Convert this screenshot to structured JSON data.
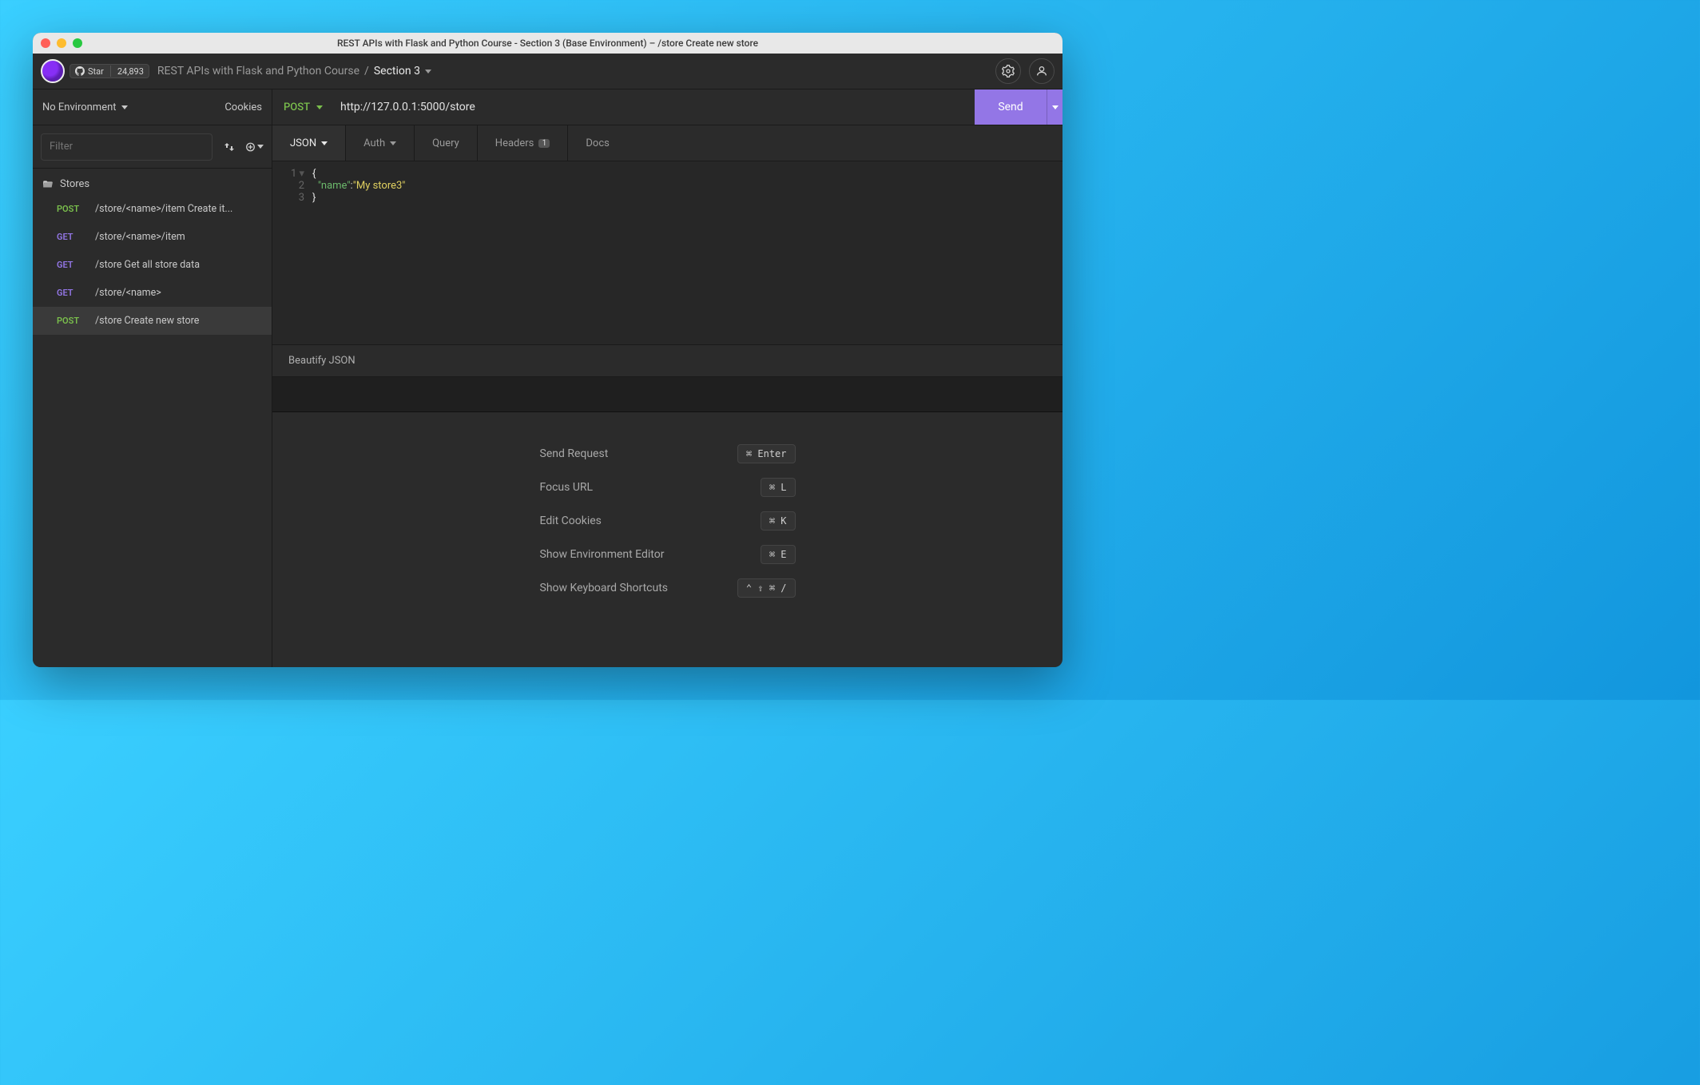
{
  "window": {
    "title": "REST APIs with Flask and Python Course - Section 3 (Base Environment) – /store Create new store"
  },
  "github": {
    "star_label": "Star",
    "star_count": "24,893"
  },
  "breadcrumb": {
    "project": "REST APIs with Flask and Python Course",
    "separator": "/",
    "current": "Section 3"
  },
  "sidebar": {
    "environment_label": "No Environment",
    "cookies_label": "Cookies",
    "filter_placeholder": "Filter",
    "folder_name": "Stores",
    "items": [
      {
        "method": "POST",
        "method_class": "post",
        "path": "/store/<name>/item Create it...",
        "active": false
      },
      {
        "method": "GET",
        "method_class": "get",
        "path": "/store/<name>/item",
        "active": false
      },
      {
        "method": "GET",
        "method_class": "get",
        "path": "/store Get all store data",
        "active": false
      },
      {
        "method": "GET",
        "method_class": "get",
        "path": "/store/<name>",
        "active": false
      },
      {
        "method": "POST",
        "method_class": "post",
        "path": "/store Create new store",
        "active": true
      }
    ]
  },
  "request": {
    "method": "POST",
    "url": "http://127.0.0.1:5000/store",
    "send_label": "Send"
  },
  "tabs": {
    "body": "JSON",
    "auth": "Auth",
    "query": "Query",
    "headers": "Headers",
    "headers_count": "1",
    "docs": "Docs"
  },
  "body_json": {
    "line1_num": "1",
    "line2_num": "2",
    "line3_num": "3",
    "open_brace": "{",
    "close_brace": "}",
    "key_quoted": "\"name\"",
    "colon": ":",
    "value_quoted": "\"My store3\""
  },
  "beautify_label": "Beautify JSON",
  "shortcuts": [
    {
      "label": "Send Request",
      "key": "⌘ Enter"
    },
    {
      "label": "Focus URL",
      "key": "⌘ L"
    },
    {
      "label": "Edit Cookies",
      "key": "⌘ K"
    },
    {
      "label": "Show Environment Editor",
      "key": "⌘ E"
    },
    {
      "label": "Show Keyboard Shortcuts",
      "key": "⌃ ⇧ ⌘ /"
    }
  ]
}
